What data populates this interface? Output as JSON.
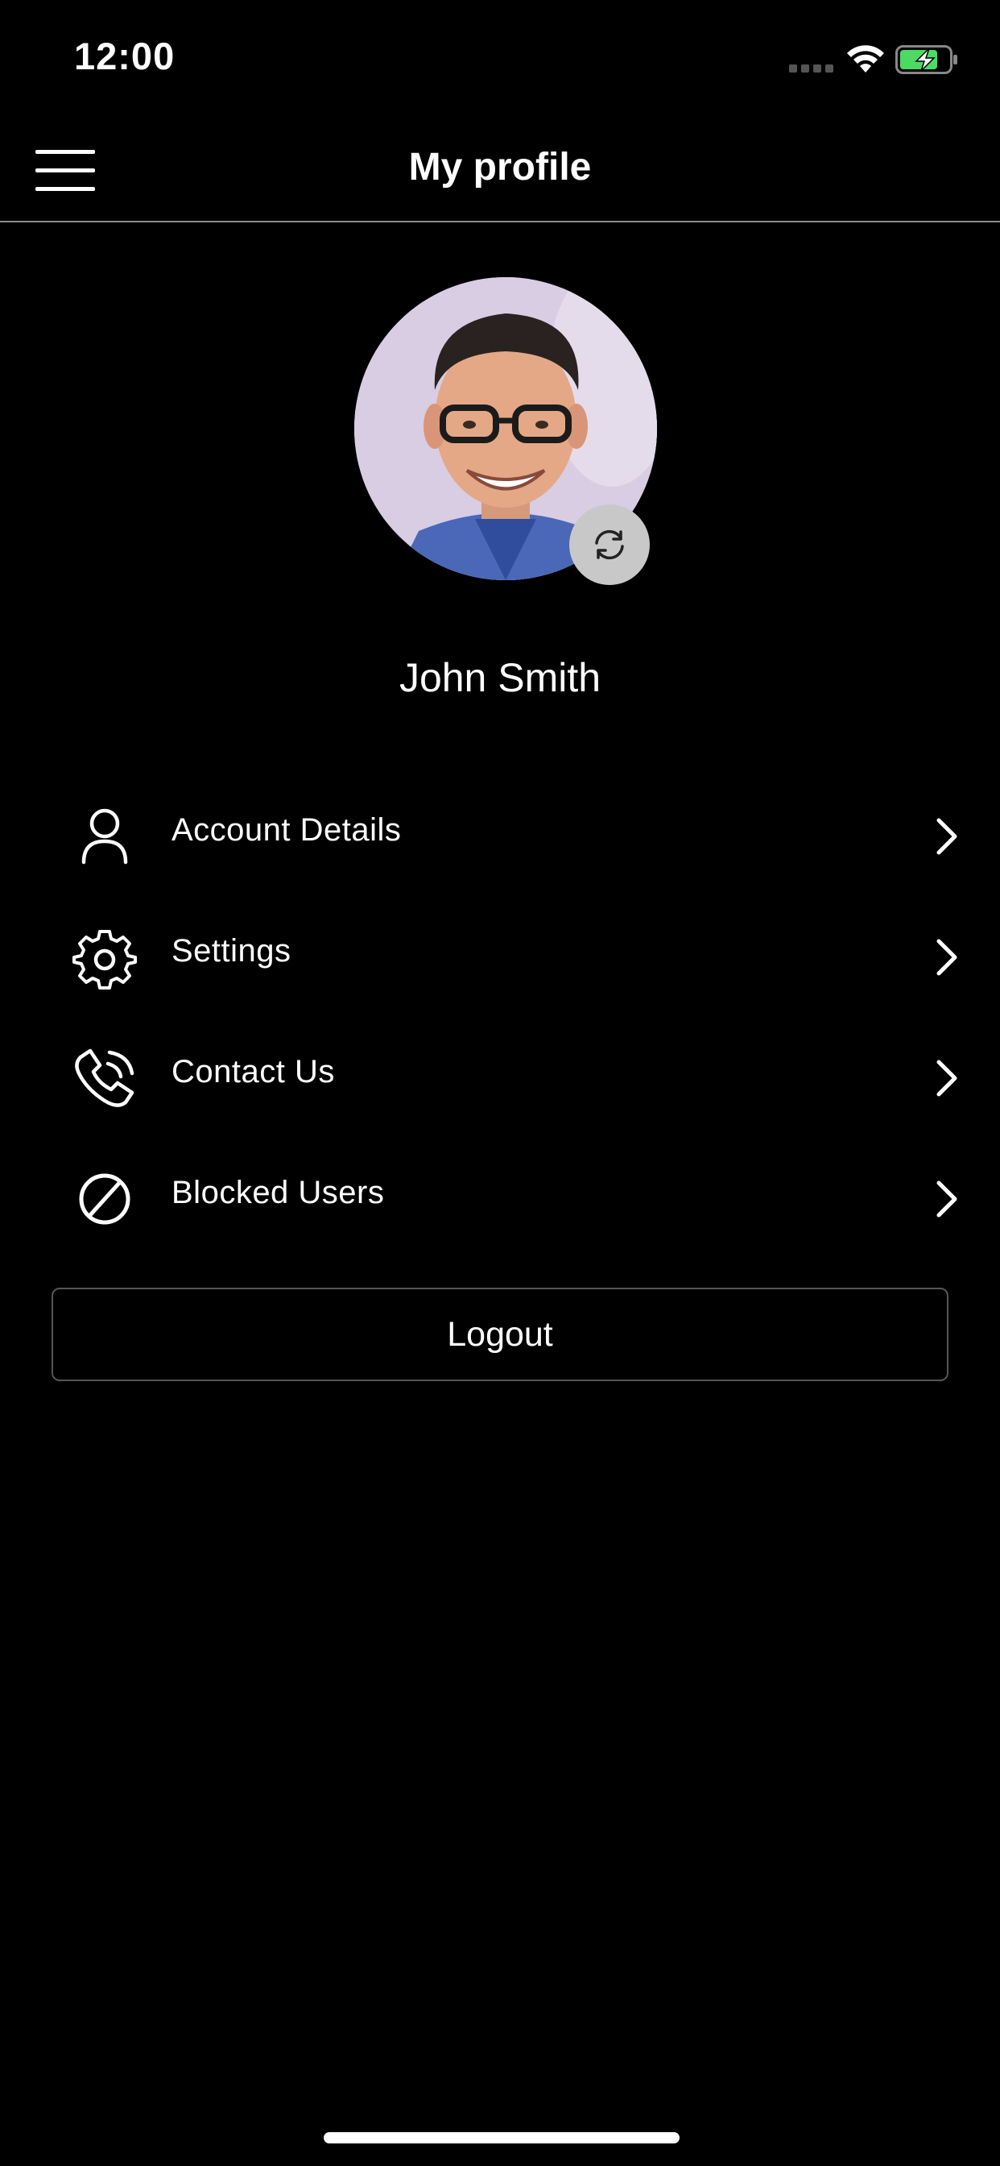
{
  "status_bar": {
    "time": "12:00",
    "signal_icon": "cellular-signal-icon",
    "wifi_icon": "wifi-icon",
    "battery_icon": "battery-charging-icon",
    "battery_color": "#4cd964"
  },
  "header": {
    "title": "My profile",
    "menu_icon": "hamburger-menu-icon"
  },
  "profile": {
    "name": "John Smith",
    "avatar_icon": "profile-photo",
    "change_photo_icon": "refresh-icon"
  },
  "menu": {
    "items": [
      {
        "label": "Account Details",
        "icon": "user-icon"
      },
      {
        "label": "Settings",
        "icon": "gear-icon"
      },
      {
        "label": "Contact Us",
        "icon": "phone-call-icon"
      },
      {
        "label": "Blocked Users",
        "icon": "block-icon"
      }
    ],
    "chevron_icon": "chevron-right-icon"
  },
  "logout": {
    "label": "Logout"
  },
  "colors": {
    "background": "#000000",
    "text": "#ffffff",
    "divider": "#8a8a8a",
    "button_border": "#555555"
  }
}
